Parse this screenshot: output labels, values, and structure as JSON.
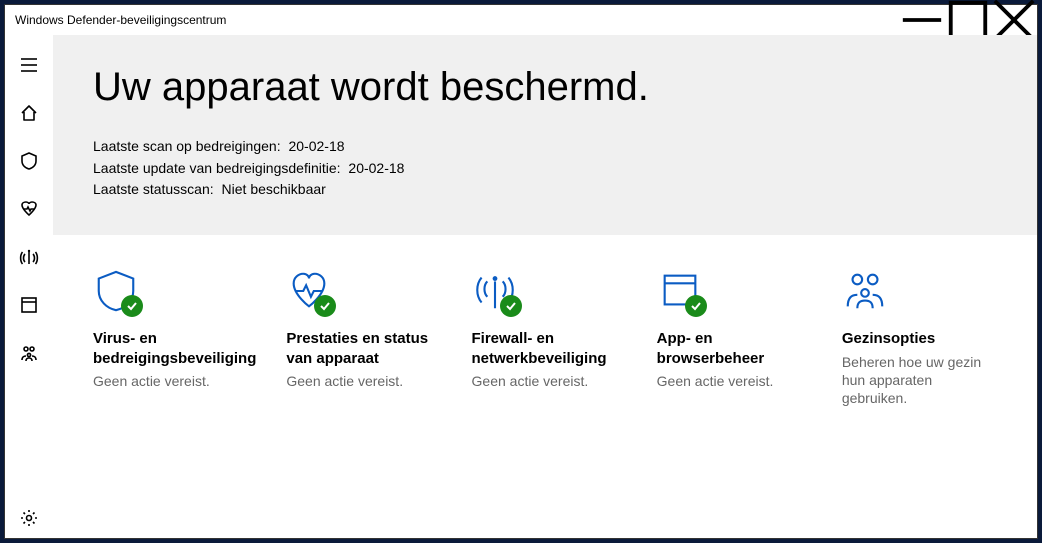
{
  "window": {
    "title": "Windows Defender-beveiligingscentrum"
  },
  "hero": {
    "headline": "Uw apparaat wordt beschermd.",
    "status": [
      {
        "label": "Laatste scan op bedreigingen:",
        "value": "20-02-18"
      },
      {
        "label": "Laatste update van bedreigingsdefinitie:",
        "value": "20-02-18"
      },
      {
        "label": "Laatste statusscan:",
        "value": "Niet beschikbaar"
      }
    ]
  },
  "cards": [
    {
      "title": "Virus- en bedreigingsbeveiliging",
      "sub": "Geen actie vereist.",
      "icon": "shield",
      "badge": true
    },
    {
      "title": "Prestaties en status van apparaat",
      "sub": "Geen actie vereist.",
      "icon": "heart",
      "badge": true
    },
    {
      "title": "Firewall- en netwerkbeveiliging",
      "sub": "Geen actie vereist.",
      "icon": "antenna",
      "badge": true
    },
    {
      "title": "App- en browserbeheer",
      "sub": "Geen actie vereist.",
      "icon": "window",
      "badge": true
    },
    {
      "title": "Gezinsopties",
      "sub": "Beheren hoe uw gezin hun apparaten gebruiken.",
      "icon": "family",
      "badge": false
    }
  ]
}
